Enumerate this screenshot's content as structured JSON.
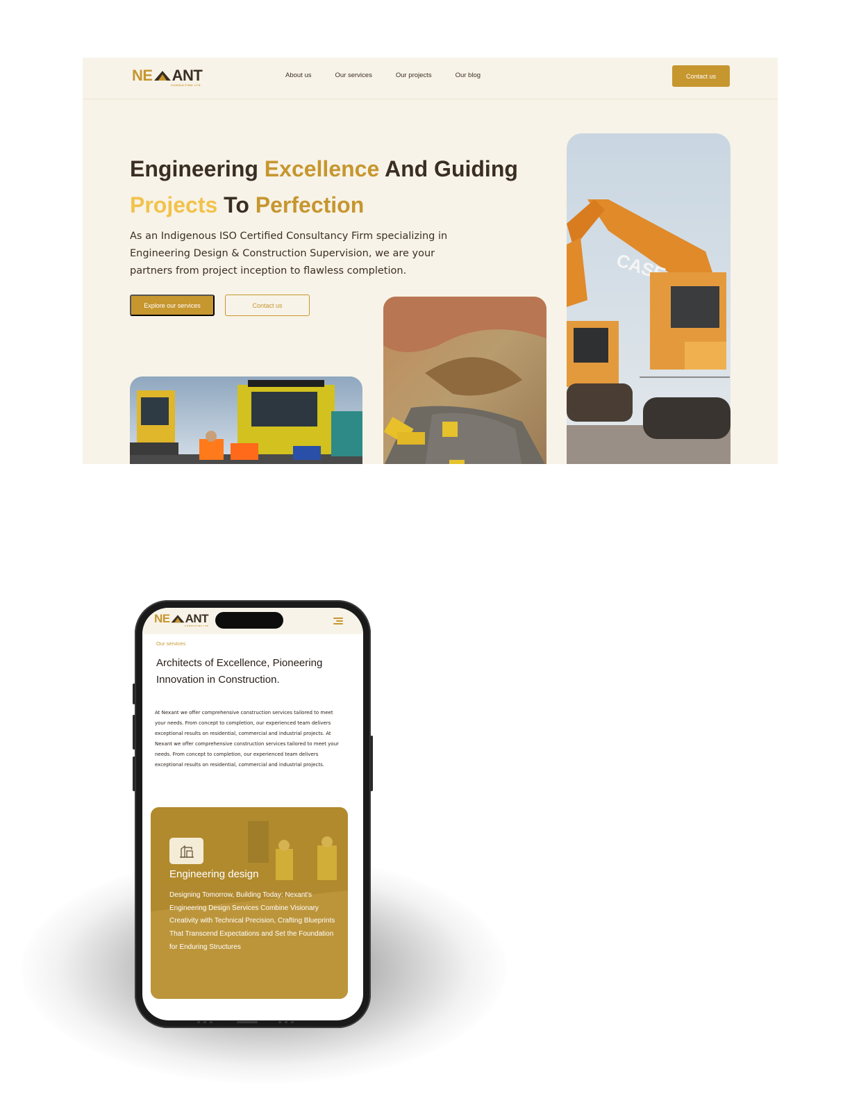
{
  "brand": {
    "logo_main_1": "NE",
    "logo_main_2": "ANT",
    "logo_sub": "CONSULTING LTD",
    "colors": {
      "gold": "#c6962f",
      "pale_gold": "#f1c24c",
      "dark": "#3a2e22",
      "cream": "#f8f3e8",
      "card_gold": "#c79b34"
    }
  },
  "desktop": {
    "nav": {
      "links": [
        "About us",
        "Our services",
        "Our projects",
        "Our blog"
      ],
      "cta": "Contact us"
    },
    "hero": {
      "title_w1": "Engineering",
      "title_w2": "Excellence",
      "title_w3": "And Guiding",
      "title_w4": "Projects",
      "title_w5": "To",
      "title_w6": "Perfection",
      "description": "As an Indigenous ISO Certified Consultancy Firm specializing in Engineering Design & Construction Supervision, we are your partners from project inception to flawless completion.",
      "primary_button": "Explore our services",
      "secondary_button": "Contact us",
      "excavator_brand": "CASE"
    }
  },
  "mobile": {
    "section_label": "Our services",
    "heading": "Architects of Excellence, Pioneering Innovation in Construction.",
    "body": "At Nexant we offer comprehensive construction services tailored to meet your needs. From concept to completion, our experienced team delivers exceptional results on residential, commercial and industrial projects. At Nexant we offer comprehensive construction services tailored to meet your needs. From concept to completion, our experienced team delivers exceptional results on residential, commercial and industrial projects.",
    "card": {
      "icon": "engineering-design-icon",
      "title": "Engineering design",
      "text": "Designing Tomorrow, Building Today: Nexant's Engineering Design Services Combine Visionary Creativity with Technical Precision, Crafting Blueprints That Transcend Expectations and Set the Foundation for Enduring Structures"
    }
  }
}
